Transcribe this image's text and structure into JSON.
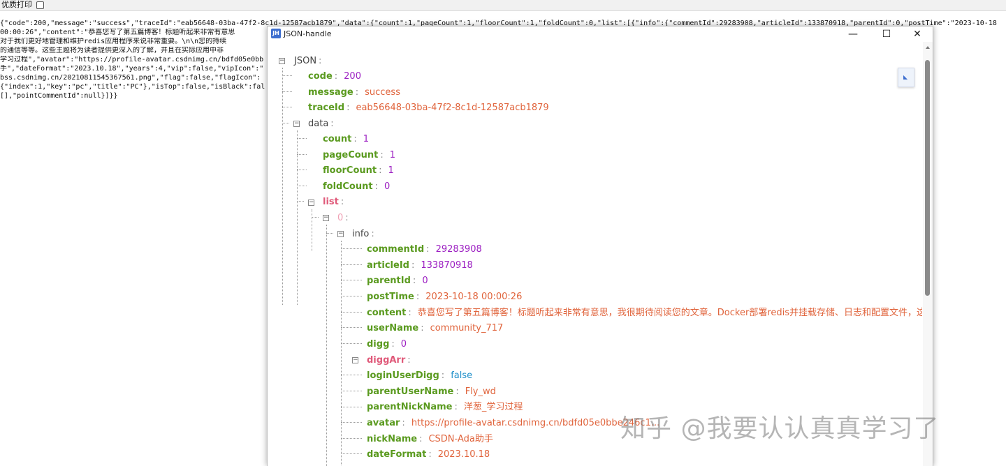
{
  "topbar": {
    "label": "优质打印"
  },
  "raw_text": {
    "lines": [
      "{\"code\":200,\"message\":\"success\",\"traceId\":\"eab56648-03ba-47f2-8c1d-12587acb1879\",\"data\":{\"count\":1,\"pageCount\":1,\"floorCount\":1,\"foldCount\":0,\"list\":[{\"info\":{\"commentId\":29283908,\"articleId\":133870918,\"parentId\":0,\"postTime\":\"2023-10-18",
      "00:00:26\",\"content\":\"恭喜您写了第五篇博客！标题听起来非常有意思                                                                                                                       志和配置文件，这",
      "对于我们更好地管理和维护redis应用程序来说非常重要。\\n\\n您的持续                                                                                                                   、如何实现容器间",
      "的通信等等。这些主题将为读者提供更深入的了解，并且在实际应用中非                                                                                                                   tNickName\":\"洋葱_",
      "学习过程\",\"avatar\":\"https://profile-avatar.csdnimg.cn/bdfd05e0bb",
      "手\",\"dateFormat\":\"2023.10.18\",\"years\":4,\"vip\":false,\"vipIcon\":\"",
      "bss.csdnimg.cn/20210811545367561.png\",\"flag\":false,\"flagIcon\":",
      "{\"index\":1,\"key\":\"pc\",\"title\":\"PC\"},\"isTop\":false,\"isBlack\":fal                                                                                                                  ,\"sub\":",
      "[],\"pointCommentId\":null}]}}"
    ]
  },
  "window": {
    "title": "JSON-handle",
    "icon_text": "JH",
    "minimize": "—",
    "maximize": "☐",
    "close": "✕"
  },
  "tree": {
    "root": "JSON",
    "code": {
      "key": "code",
      "value": "200"
    },
    "message": {
      "key": "message",
      "value": "success"
    },
    "traceId": {
      "key": "traceId",
      "value": "eab56648-03ba-47f2-8c1d-12587acb1879"
    },
    "data": "data",
    "count": {
      "key": "count",
      "value": "1"
    },
    "pageCount": {
      "key": "pageCount",
      "value": "1"
    },
    "floorCount": {
      "key": "floorCount",
      "value": "1"
    },
    "foldCount": {
      "key": "foldCount",
      "value": "0"
    },
    "list": "list",
    "index0": "0",
    "info": "info",
    "commentId": {
      "key": "commentId",
      "value": "29283908"
    },
    "articleId": {
      "key": "articleId",
      "value": "133870918"
    },
    "parentId": {
      "key": "parentId",
      "value": "0"
    },
    "postTime": {
      "key": "postTime",
      "value": "2023-10-18 00:00:26"
    },
    "content": {
      "key": "content",
      "value": "恭喜您写了第五篇博客！标题听起来非常有意思，我很期待阅读您的文章。Docker部署redis并挂载存储、日志和配置文件，这"
    },
    "userName": {
      "key": "userName",
      "value": "community_717"
    },
    "digg": {
      "key": "digg",
      "value": "0"
    },
    "diggArr": "diggArr",
    "loginUserDigg": {
      "key": "loginUserDigg",
      "value": "false"
    },
    "parentUserName": {
      "key": "parentUserName",
      "value": "Fly_wd"
    },
    "parentNickName": {
      "key": "parentNickName",
      "value": "洋葱_学习过程"
    },
    "avatar": {
      "key": "avatar",
      "value": "https://profile-avatar.csdnimg.cn/bdfd05e0bbe246c1..."
    },
    "nickName": {
      "key": "nickName",
      "value": "CSDN-Ada助手"
    },
    "dateFormat": {
      "key": "dateFormat",
      "value": "2023.10.18"
    }
  },
  "watermark": "知乎 @我要认认真真学习了",
  "colors": {
    "key": "#5a9a1f",
    "number": "#9c1fc2",
    "string": "#e0643c",
    "boolean": "#1f8fc9",
    "array_key": "#e05a7a"
  }
}
